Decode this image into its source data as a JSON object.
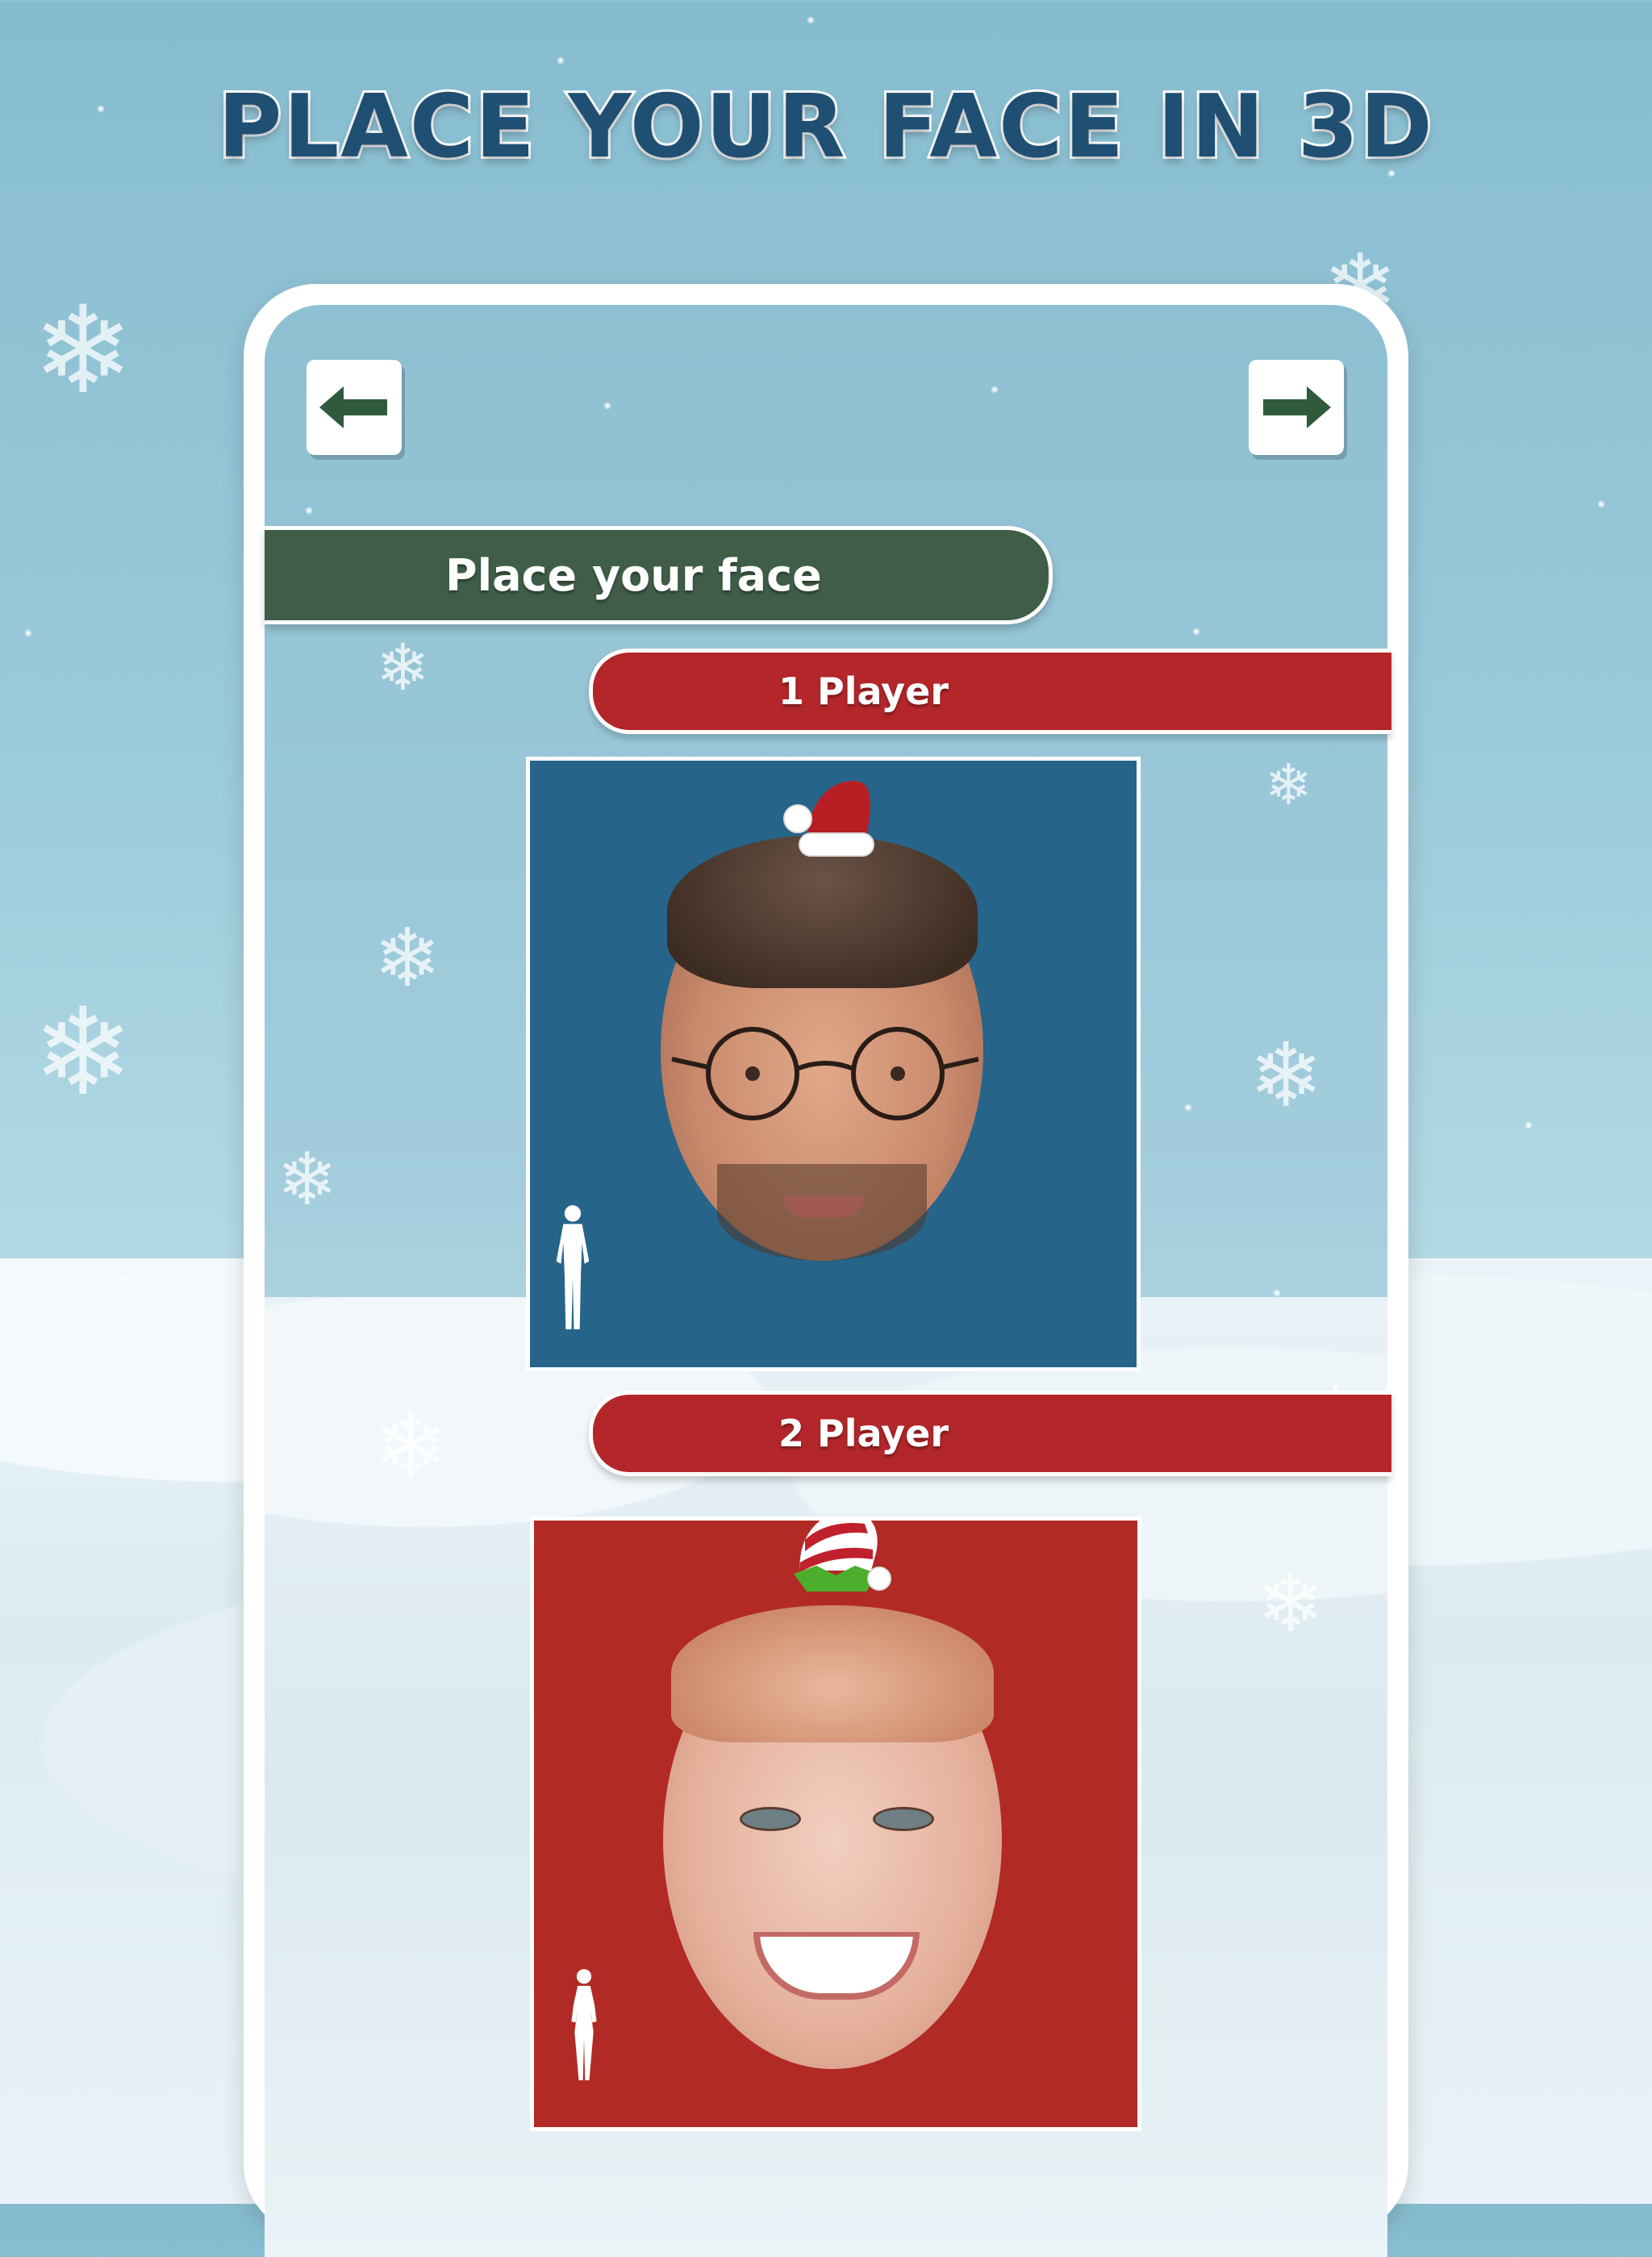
{
  "headline": "PLACE YOUR FACE IN 3D",
  "nav": {
    "back_icon": "arrow-left-icon",
    "next_icon": "arrow-right-icon"
  },
  "section": {
    "title": "Place your face"
  },
  "players": [
    {
      "label": "1 Player",
      "card_color": "#276489",
      "hat": "santa-hat-icon",
      "body": "male-body-icon"
    },
    {
      "label": "2 Player",
      "card_color": "#b12a25",
      "hat": "elf-hat-icon",
      "body": "female-body-icon"
    }
  ],
  "colors": {
    "headline": "#1f4f72",
    "section_bar": "#405e47",
    "player_bar": "#b3262a",
    "arrow": "#2f5a3b"
  }
}
